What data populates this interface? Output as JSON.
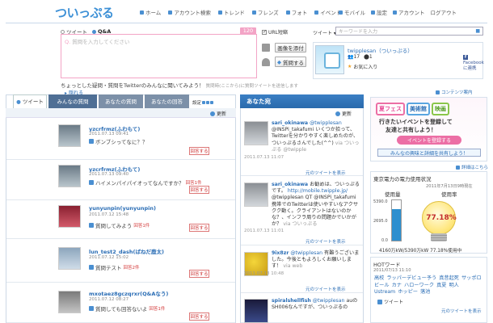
{
  "header": {
    "logo": "ついっぷる",
    "nav": [
      "ホーム",
      "アカウント検索",
      "トレンド",
      "フレンズ",
      "フォト",
      "イベント"
    ],
    "subnav": [
      "モバイル",
      "設定",
      "アカウント",
      "ログアウト"
    ]
  },
  "compose": {
    "tab_tweet": "ツイート",
    "tab_qa": "Q&A",
    "counter": "120",
    "placeholder_prefix": "Q.",
    "placeholder": "質問を入力してください",
    "url_shorten": "URL短縮",
    "attach_image": "画像を添付",
    "ask_button": "質問する",
    "helper_text": "ちょっとした疑問・質問をTwitterのみんなに聞いてみよう！",
    "helper_small": "質問時(ここから)に質問ツイートを送信します",
    "hide_link": "隠れる"
  },
  "search": {
    "label": "ツイート",
    "placeholder": "キーワードを入力"
  },
  "profile": {
    "name": "twipplesan（ついっぷる）",
    "stat1": "17",
    "stat2": "1",
    "favorite": "お気に入り",
    "fb1": "Facebook",
    "fb2": "に連携"
  },
  "left_tabs": [
    "ツイート",
    "みんなの質問",
    "あなたの質問",
    "あなたの回答"
  ],
  "left_settings": "設定",
  "left_update": "更新",
  "questions": [
    {
      "name": "yzcrfrmz(ふわもて)",
      "date": "2011.07.13 09:41",
      "text": "ボンブシってなに？？",
      "answers": "",
      "btn": "回答する"
    },
    {
      "name": "yzcrfrmz(ふわもて)",
      "date": "2011.07.13 09:40",
      "text": "ハイメンパイパイオってなんですか？",
      "answers": "回答1件",
      "btn": "回答する"
    },
    {
      "name": "yunyunpin(yunyunpin)",
      "date": "2011.07.12 15:48",
      "text": "質問してみよう",
      "answers": "回答1件",
      "btn": "回答する"
    },
    {
      "name": "lun_test2_dash(ばねだ鹿太)",
      "date": "2011.07.12 15:02",
      "text": "質問テスト",
      "answers": "回答2件",
      "btn": "回答する"
    },
    {
      "name": "mxotaez8gczqrxr(Q&Aなう)",
      "date": "2011.07.12 08:27",
      "text": "質問しても回答ないよ",
      "answers": "回答1件",
      "btn": "回答する"
    }
  ],
  "mid": {
    "title": "あなた宛",
    "update": "更新",
    "more": "元のツイートを表示",
    "items": [
      {
        "user": "sari_okinawa",
        "at": "@twipplesan",
        "text": "@INSPi_takafumi いくつか拾って、Twitterを分かりやすく楽しめたのが、ついっぷるさんでした(^^)",
        "via": "via ついっぷる",
        "date": "2011.07.13 11:07",
        "src": "@twipple"
      },
      {
        "user": "sari_okinawa",
        "at": "",
        "text": "お勧めは、ついっぷるです。",
        "link": "http://mobile.twipple.jp/",
        "text2": "@twipplesan QT @INSPi_takafumi 携帯でのTwitterは使いやすいなアクサクク動く。クライアントはないのかな？、インフラ周りの問題かでいかがか？",
        "via": "via ついっぷる",
        "date": "2011.07.13 11:01"
      },
      {
        "user": "9ix8zr",
        "at": "@twipplesan",
        "text": "有難うございました。今後ともよろしくお願いします！",
        "via": "via web",
        "date": "2011.07.13 10:48"
      },
      {
        "user": "spiralshellfish",
        "at": "@twipplesan",
        "text": "auのSH006なんですが、ついっぷるの",
        "via": "",
        "date": ""
      }
    ]
  },
  "right": {
    "content_link": "コンテンツ案内",
    "banner_tags": [
      "夏フェス",
      "美術館",
      "映画"
    ],
    "banner_line1": "行きたいイベントを登録して",
    "banner_line2": "友達と共有しよう！",
    "banner_pill": "イベントを登録する",
    "banner_bottom": "みんなの興味と詳細を共有しよう！",
    "detail": "詳細はこちら"
  },
  "power": {
    "title": "東京電力の電力使用状況",
    "date": "2011年7月13日9時現在",
    "label_usage": "使用量",
    "label_rate": "使用率",
    "axis_top": "5390.0",
    "axis_mid": "2695.0",
    "axis_bottom": "0.0",
    "percent_text": "77.18%",
    "percent": 77.18,
    "footer": "4160万kW/5390万kW 77.18%使用中",
    "bar_color": "#2d8fcf"
  },
  "hot": {
    "title": "HOTワード",
    "date": "2011/07/13 11:10",
    "words": [
      "高校",
      "ラッパーデビュー予う",
      "真昔起死",
      "サッポロビール",
      "カナ",
      "ハローワーク",
      "真夏",
      "明人",
      "Ustream",
      "ホッピー",
      "落池"
    ],
    "tweet": "ツイート",
    "more": "元のツイートを表示"
  },
  "colors": {
    "accent": "#3b8fd6",
    "pink": "#ec6fa5",
    "nav_blue": "#4a8fd1"
  }
}
